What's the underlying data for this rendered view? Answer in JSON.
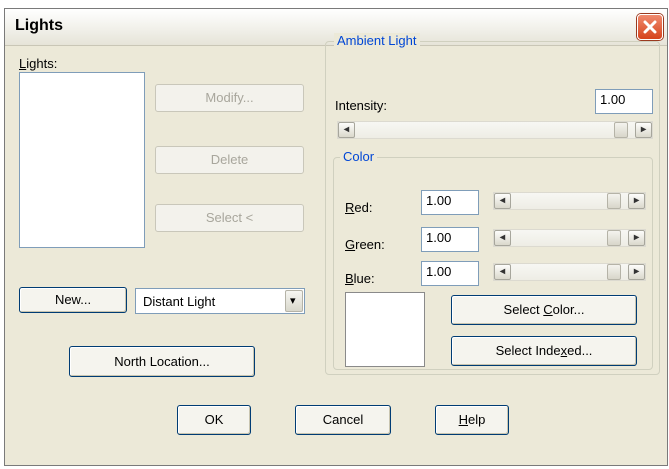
{
  "window": {
    "title": "Lights"
  },
  "lights_list": {
    "label": "Lights:"
  },
  "buttons": {
    "modify": "Modify...",
    "delete": "Delete",
    "select": "Select <",
    "new": "New...",
    "north_location": "North Location...",
    "ok": "OK",
    "cancel": "Cancel",
    "help": "Help",
    "select_color": "Select Color...",
    "select_indexed": "Select Indexed..."
  },
  "light_type": {
    "selected": "Distant Light"
  },
  "ambient": {
    "group_title": "Ambient Light",
    "intensity_label": "Intensity:",
    "intensity_value": "1.00",
    "intensity_level": 1.0
  },
  "color": {
    "group_title": "Color",
    "red_label": "Red:",
    "red_value": "1.00",
    "red_level": 1.0,
    "green_label": "Green:",
    "green_value": "1.00",
    "green_level": 1.0,
    "blue_label": "Blue:",
    "blue_value": "1.00",
    "blue_level": 1.0,
    "swatch_color": "#ffffff"
  },
  "icons": {
    "scroll_left": "◂",
    "scroll_right": "▸",
    "dropdown": "▾"
  },
  "colors": {
    "accent": "#0046d5",
    "close": "#d5421c"
  }
}
